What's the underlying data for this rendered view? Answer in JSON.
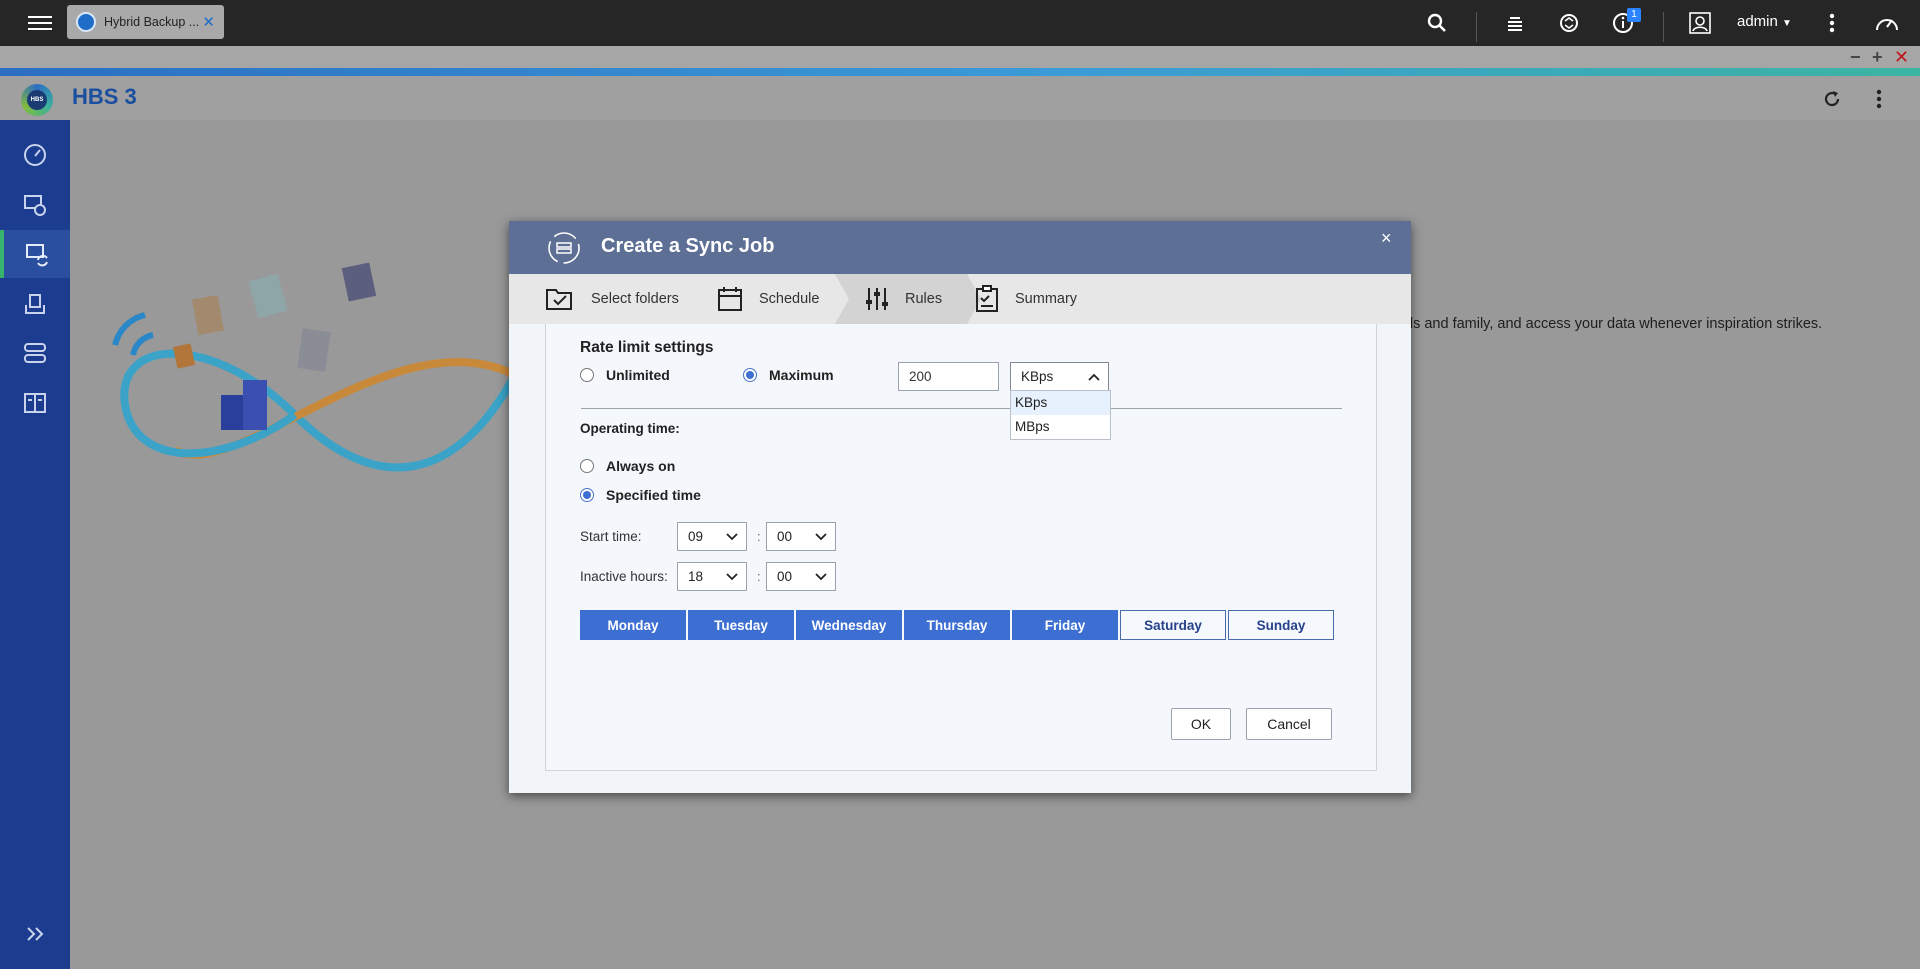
{
  "taskbar": {
    "app_tab_label": "Hybrid Backup ...",
    "notification_count": "1",
    "user": "admin"
  },
  "app": {
    "title": "HBS 3",
    "logo_text": "HBS"
  },
  "background": {
    "tagline": "ds and family, and access your data whenever inspiration strikes."
  },
  "dialog": {
    "title": "Create a Sync Job",
    "steps": [
      {
        "label": "Select folders"
      },
      {
        "label": "Schedule"
      },
      {
        "label": "Rules"
      },
      {
        "label": "Summary"
      }
    ],
    "active_step": "Rules",
    "rate_limit": {
      "heading": "Rate limit settings",
      "option_unlimited": "Unlimited",
      "option_maximum": "Maximum",
      "selected": "Maximum",
      "value": "200",
      "unit": "KBps",
      "unit_options": [
        "KBps",
        "MBps"
      ]
    },
    "operating_time": {
      "heading": "Operating time:",
      "option_always": "Always on",
      "option_specified": "Specified time",
      "selected": "Specified time",
      "start_label": "Start time:",
      "start_hour": "09",
      "start_minute": "00",
      "inactive_label": "Inactive hours:",
      "inactive_hour": "18",
      "inactive_minute": "00",
      "separator": ":"
    },
    "days": [
      {
        "label": "Monday",
        "selected": true
      },
      {
        "label": "Tuesday",
        "selected": true
      },
      {
        "label": "Wednesday",
        "selected": true
      },
      {
        "label": "Thursday",
        "selected": true
      },
      {
        "label": "Friday",
        "selected": true
      },
      {
        "label": "Saturday",
        "selected": false
      },
      {
        "label": "Sunday",
        "selected": false
      }
    ],
    "ok_label": "OK",
    "cancel_label": "Cancel",
    "close_glyph": "×"
  },
  "colors": {
    "sidebar": "#1c3c8f",
    "dialog_header": "#5e6f95",
    "accent": "#3d6fd3",
    "active_indicator": "#36b36d"
  },
  "icons": {
    "taskbar": [
      "menu-icon",
      "search-icon",
      "stack-icon",
      "sync-icon",
      "info-icon",
      "user-icon",
      "more-icon",
      "dashboard-icon"
    ],
    "sidebar": [
      "overview-icon",
      "backup-restore-icon",
      "sync-icon",
      "storage-space-icon",
      "services-icon",
      "logs-icon",
      "expand-icon"
    ]
  }
}
